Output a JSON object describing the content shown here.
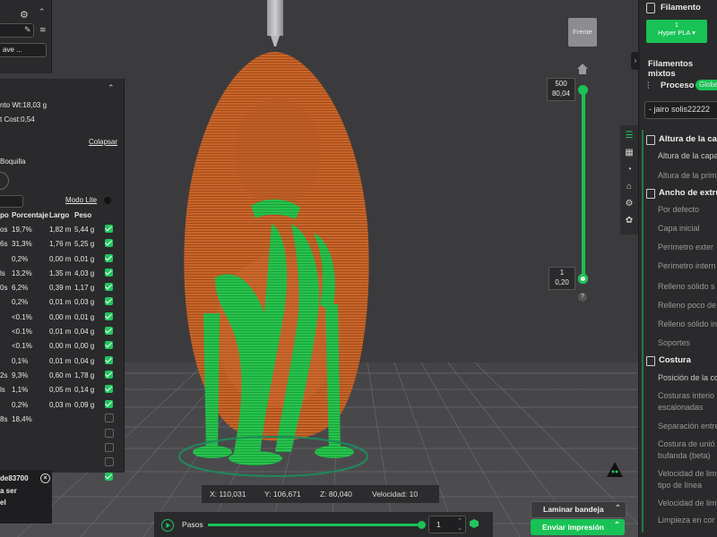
{
  "top_left": {
    "input_value": "",
    "save_label": "ave ..."
  },
  "summary": {
    "weight": "nto Wt:18,03 g",
    "cost": "t Cost:0,54",
    "collapse_label": "Colapsar",
    "nozzle_label": "Boquilla",
    "lite_mode_label": "Modo Lite",
    "columns": [
      "po",
      "Porcentaje",
      "Largo",
      "Peso"
    ],
    "rows": [
      {
        "name": "os",
        "pct": "19,7%",
        "len": "1,82 m",
        "weight": "5,44 g",
        "checked": true
      },
      {
        "name": "6s",
        "pct": "31,3%",
        "len": "1,76 m",
        "weight": "5,25 g",
        "checked": true
      },
      {
        "name": "",
        "pct": "0,2%",
        "len": "0,00 m",
        "weight": "0,01 g",
        "checked": true
      },
      {
        "name": "ls",
        "pct": "13,2%",
        "len": "1,35 m",
        "weight": "4,03 g",
        "checked": true
      },
      {
        "name": "0s",
        "pct": "6,2%",
        "len": "0,39 m",
        "weight": "1,17 g",
        "checked": true
      },
      {
        "name": "",
        "pct": "0,2%",
        "len": "0,01 m",
        "weight": "0,03 g",
        "checked": true
      },
      {
        "name": "",
        "pct": "<0.1%",
        "len": "0,00 m",
        "weight": "0,01 g",
        "checked": true
      },
      {
        "name": "",
        "pct": "<0.1%",
        "len": "0,01 m",
        "weight": "0,04 g",
        "checked": true
      },
      {
        "name": "",
        "pct": "<0.1%",
        "len": "0,00 m",
        "weight": "0,00 g",
        "checked": true
      },
      {
        "name": "",
        "pct": "0,1%",
        "len": "0,01 m",
        "weight": "0,04 g",
        "checked": true
      },
      {
        "name": "2s",
        "pct": "9,3%",
        "len": "0,60 m",
        "weight": "1,78 g",
        "checked": true
      },
      {
        "name": "ls",
        "pct": "1,1%",
        "len": "0,05 m",
        "weight": "0,14 g",
        "checked": true
      },
      {
        "name": "",
        "pct": "0,2%",
        "len": "0,03 m",
        "weight": "0,09 g",
        "checked": true
      },
      {
        "name": "8s",
        "pct": "18,4%",
        "len": "",
        "weight": "",
        "checked": false
      },
      {
        "name": "",
        "pct": "",
        "len": "",
        "weight": "",
        "checked": false
      },
      {
        "name": "",
        "pct": "",
        "len": "",
        "weight": "",
        "checked": false
      },
      {
        "name": "",
        "pct": "",
        "len": "",
        "weight": "",
        "checked": false
      },
      {
        "name": "",
        "pct": "",
        "len": "",
        "weight": "",
        "checked": true
      }
    ]
  },
  "notification": {
    "line1": "de83700",
    "line2": "a ser",
    "line3": "el"
  },
  "viewport": {
    "view_cube_label": "Frente",
    "slider_top_layer": "500",
    "slider_top_height": "80,04",
    "slider_bottom_layer": "1",
    "slider_bottom_height": "0,20",
    "help_label": "?",
    "coords": {
      "x": "X: 110,031",
      "y": "Y: 106,671",
      "z": "Z: 80,040",
      "speed": "Velocidad: 10"
    },
    "steps_label": "Pasos",
    "steps_value": "1"
  },
  "actions": {
    "slice_label": "Laminar bandeja",
    "send_label": "Enviar impresión"
  },
  "right_panel": {
    "filament_title": "Filamento",
    "filament_slot": "1",
    "filament_name": "Hyper PLA",
    "mixed_filaments": "Filamentos mixtos",
    "process_label": "Proceso",
    "global_badge": "Globa",
    "profile_name": "jairo solis22222",
    "sections": [
      {
        "type": "head",
        "text": "Altura de la capa"
      },
      {
        "type": "sub",
        "text": "Altura de la capa"
      },
      {
        "type": "item",
        "text": "Altura de la prim"
      },
      {
        "type": "head",
        "text": "Ancho de extrusió"
      },
      {
        "type": "item",
        "text": "Por defecto"
      },
      {
        "type": "item",
        "text": "Capa inicial"
      },
      {
        "type": "item",
        "text": "Perímetro exter"
      },
      {
        "type": "item",
        "text": "Perímetro intern"
      },
      {
        "type": "item",
        "text": "Relleno sólido s"
      },
      {
        "type": "item",
        "text": "Relleno poco de"
      },
      {
        "type": "item",
        "text": "Relleno sólido in"
      },
      {
        "type": "item",
        "text": "Soportes"
      },
      {
        "type": "head",
        "text": "Costura"
      },
      {
        "type": "sub",
        "text": "Posición de la co"
      },
      {
        "type": "item",
        "text": "Costuras interio"
      },
      {
        "type": "item",
        "text": "escalonadas"
      },
      {
        "type": "item",
        "text": "Separación entre"
      },
      {
        "type": "item",
        "text": "Costura de unió"
      },
      {
        "type": "item",
        "text": "bufanda (beta)"
      },
      {
        "type": "item",
        "text": "Velocidad de lim"
      },
      {
        "type": "item",
        "text": "tipo de línea"
      },
      {
        "type": "item",
        "text": "Velocidad de lim"
      },
      {
        "type": "item",
        "text": "Limpieza en cor"
      }
    ]
  },
  "colors": {
    "accent": "#18c255",
    "model": "#c8652a",
    "support": "#22c55e",
    "panel": "#2a2a2c",
    "background": "#3a3a3d"
  }
}
